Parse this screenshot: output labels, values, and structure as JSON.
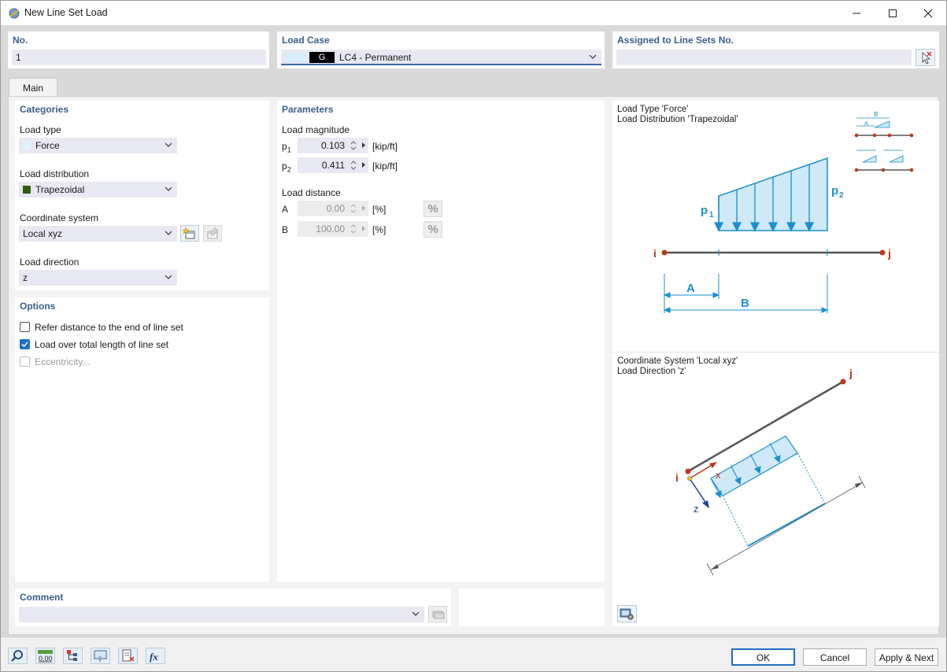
{
  "window": {
    "title": "New Line Set Load"
  },
  "header": {
    "no_label": "No.",
    "no_value": "1",
    "load_case_label": "Load Case",
    "load_case_tag": "G",
    "load_case_value": "LC4 - Permanent",
    "assigned_label": "Assigned to Line Sets No.",
    "assigned_value": ""
  },
  "tabs": [
    {
      "label": "Main"
    }
  ],
  "categories": {
    "title": "Categories",
    "load_type_label": "Load type",
    "load_type_value": "Force",
    "load_type_color": "#dff3fb",
    "load_distribution_label": "Load distribution",
    "load_distribution_value": "Trapezoidal",
    "load_distribution_color": "#2e5d12",
    "coordinate_system_label": "Coordinate system",
    "coordinate_system_value": "Local xyz",
    "load_direction_label": "Load direction",
    "load_direction_value": "z"
  },
  "options": {
    "title": "Options",
    "items": [
      {
        "label": "Refer distance to the end of line set",
        "checked": false,
        "enabled": true
      },
      {
        "label": "Load over total length of line set",
        "checked": true,
        "enabled": true
      },
      {
        "label": "Eccentricity...",
        "checked": false,
        "enabled": false
      }
    ]
  },
  "parameters": {
    "title": "Parameters",
    "magnitude_label": "Load magnitude",
    "p1_label": "p",
    "p1_sub": "1",
    "p1_value": "0.103",
    "p1_unit": "[kip/ft]",
    "p2_label": "p",
    "p2_sub": "2",
    "p2_value": "0.411",
    "p2_unit": "[kip/ft]",
    "distance_label": "Load distance",
    "a_label": "A",
    "a_value": "0.00",
    "a_unit": "[%]",
    "b_label": "B",
    "b_value": "100.00",
    "b_unit": "[%]",
    "percent_symbol": "%"
  },
  "diagram_top": {
    "line1": "Load Type 'Force'",
    "line2": "Load Distribution 'Trapezoidal'",
    "p1": "p",
    "p1_sub": "1",
    "p2": "p",
    "p2_sub": "2",
    "node_i": "i",
    "node_j": "j",
    "dim_a": "A",
    "dim_b": "B",
    "mini_a": "A",
    "mini_b": "B"
  },
  "diagram_bottom": {
    "line1": "Coordinate System 'Local xyz'",
    "line2": "Load Direction 'z'",
    "node_i": "i",
    "node_j": "j",
    "axis_x": "x",
    "axis_z": "z"
  },
  "comment": {
    "label": "Comment",
    "value": ""
  },
  "buttons": {
    "ok": "OK",
    "cancel": "Cancel",
    "apply_next": "Apply & Next"
  },
  "toolbar_values": {
    "units_icon_text": "0,00"
  },
  "colors": {
    "accent": "#1f6fc5",
    "label": "#3b5f8a",
    "load_fill": "#cfe9f7",
    "load_stroke": "#1a8fd0",
    "node": "#c0391b"
  }
}
